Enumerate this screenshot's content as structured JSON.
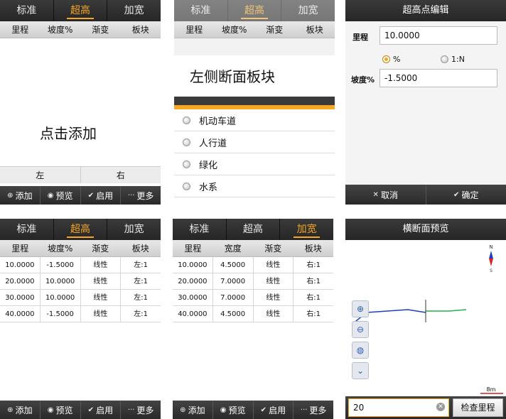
{
  "tabs": [
    "标准",
    "超高",
    "加宽"
  ],
  "super_table": {
    "headers": [
      "里程",
      "坡度%",
      "渐变",
      "板块"
    ],
    "rows": [
      [
        "10.0000",
        "-1.5000",
        "线性",
        "左:1"
      ],
      [
        "20.0000",
        "10.0000",
        "线性",
        "左:1"
      ],
      [
        "30.0000",
        "10.0000",
        "线性",
        "左:1"
      ],
      [
        "40.0000",
        "-1.5000",
        "线性",
        "左:1"
      ]
    ]
  },
  "widen_table": {
    "headers": [
      "里程",
      "宽度",
      "渐变",
      "板块"
    ],
    "rows": [
      [
        "10.0000",
        "4.5000",
        "线性",
        "右:1"
      ],
      [
        "20.0000",
        "7.0000",
        "线性",
        "右:1"
      ],
      [
        "30.0000",
        "7.0000",
        "线性",
        "右:1"
      ],
      [
        "40.0000",
        "4.5000",
        "线性",
        "右:1"
      ]
    ]
  },
  "empty_panel": {
    "hint": "点击添加",
    "left": "左",
    "right": "右"
  },
  "toolbar": {
    "add": "添加",
    "preview": "预览",
    "enable": "启用",
    "more": "更多"
  },
  "caption_left_block": "左侧断面板块",
  "block_list": [
    "机动车道",
    "人行道",
    "绿化",
    "水系"
  ],
  "edit_dialog": {
    "title": "超高点编辑",
    "mileage_label": "里程",
    "mileage_value": "10.0000",
    "option_percent": "%",
    "option_ratio": "1:N",
    "slope_label": "坡度%",
    "slope_value": "-1.5000",
    "cancel": "取消",
    "confirm": "确定"
  },
  "preview": {
    "title": "横断面预览",
    "scale_label": "8m",
    "mileage_input": "20",
    "check_button": "检查里程",
    "compass_n": "N",
    "compass_s": "S"
  },
  "colors": {
    "accent": "#f6a623",
    "left_line": "#1e3fbf",
    "right_line": "#22b14c"
  }
}
